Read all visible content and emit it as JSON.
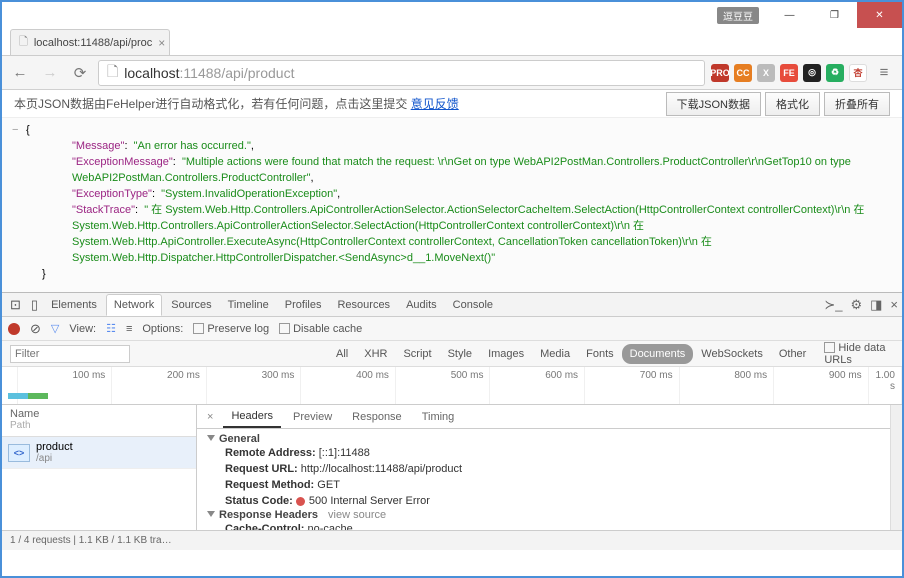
{
  "window": {
    "badge": "逗豆豆",
    "minimize": "—",
    "maximize": "❐",
    "close": "✕"
  },
  "tab": {
    "title": "localhost:11488/api/proc",
    "icon": "🗋"
  },
  "address": {
    "host": "localhost",
    "path": ":11488/api/product",
    "pageIcon": "🗋"
  },
  "extensions": [
    "PRO",
    "CC",
    "X",
    "FE",
    "◎",
    "♻",
    "杏"
  ],
  "fehelper": {
    "text": "本页JSON数据由FeHelper进行自动格式化，若有任何问题，点击这里提交 ",
    "link": "意见反馈",
    "buttons": [
      "下载JSON数据",
      "格式化",
      "折叠所有"
    ]
  },
  "json": {
    "k_message": "\"Message\"",
    "v_message": "\"An error has occurred.\"",
    "k_exmsg": "\"ExceptionMessage\"",
    "v_exmsg": "\"Multiple actions were found that match the request: \\r\\nGet on type WebAPI2PostMan.Controllers.ProductController\\r\\nGetTop10 on type WebAPI2PostMan.Controllers.ProductController\"",
    "k_extype": "\"ExceptionType\"",
    "v_extype": "\"System.InvalidOperationException\"",
    "k_stack": "\"StackTrace\"",
    "v_stack": "\"   在 System.Web.Http.Controllers.ApiControllerActionSelector.ActionSelectorCacheItem.SelectAction(HttpControllerContext controllerContext)\\r\\n   在 System.Web.Http.Controllers.ApiControllerActionSelector.SelectAction(HttpControllerContext controllerContext)\\r\\n   在 System.Web.Http.ApiController.ExecuteAsync(HttpControllerContext controllerContext, CancellationToken cancellationToken)\\r\\n   在 System.Web.Http.Dispatcher.HttpControllerDispatcher.<SendAsync>d__1.MoveNext()\""
  },
  "devtools": {
    "tabs": [
      "Elements",
      "Network",
      "Sources",
      "Timeline",
      "Profiles",
      "Resources",
      "Audits",
      "Console"
    ],
    "toolbar": {
      "view": "View:",
      "options": "Options:",
      "preserve": "Preserve log",
      "disable": "Disable cache"
    },
    "filters": [
      "All",
      "XHR",
      "Script",
      "Style",
      "Images",
      "Media",
      "Fonts",
      "Documents",
      "WebSockets",
      "Other"
    ],
    "filter_placeholder": "Filter",
    "hide_data": "Hide data URLs",
    "timeline": [
      "100 ms",
      "200 ms",
      "300 ms",
      "400 ms",
      "500 ms",
      "600 ms",
      "700 ms",
      "800 ms",
      "900 ms",
      "1.00 s"
    ]
  },
  "requests": {
    "head_name": "Name",
    "head_path": "Path",
    "item_name": "product",
    "item_path": "/api"
  },
  "detail": {
    "tabs": [
      "Headers",
      "Preview",
      "Response",
      "Timing"
    ],
    "general": "General",
    "remote_l": "Remote Address:",
    "remote_v": "[::1]:11488",
    "url_l": "Request URL:",
    "url_v": "http://localhost:11488/api/product",
    "method_l": "Request Method:",
    "method_v": "GET",
    "status_l": "Status Code:",
    "status_v": "500 Internal Server Error",
    "resp_h": "Response Headers",
    "viewsrc": "view source",
    "cache_l": "Cache-Control:",
    "cache_v": "no-cache"
  },
  "statusbar": "1 / 4 requests | 1.1 KB / 1.1 KB tra…"
}
